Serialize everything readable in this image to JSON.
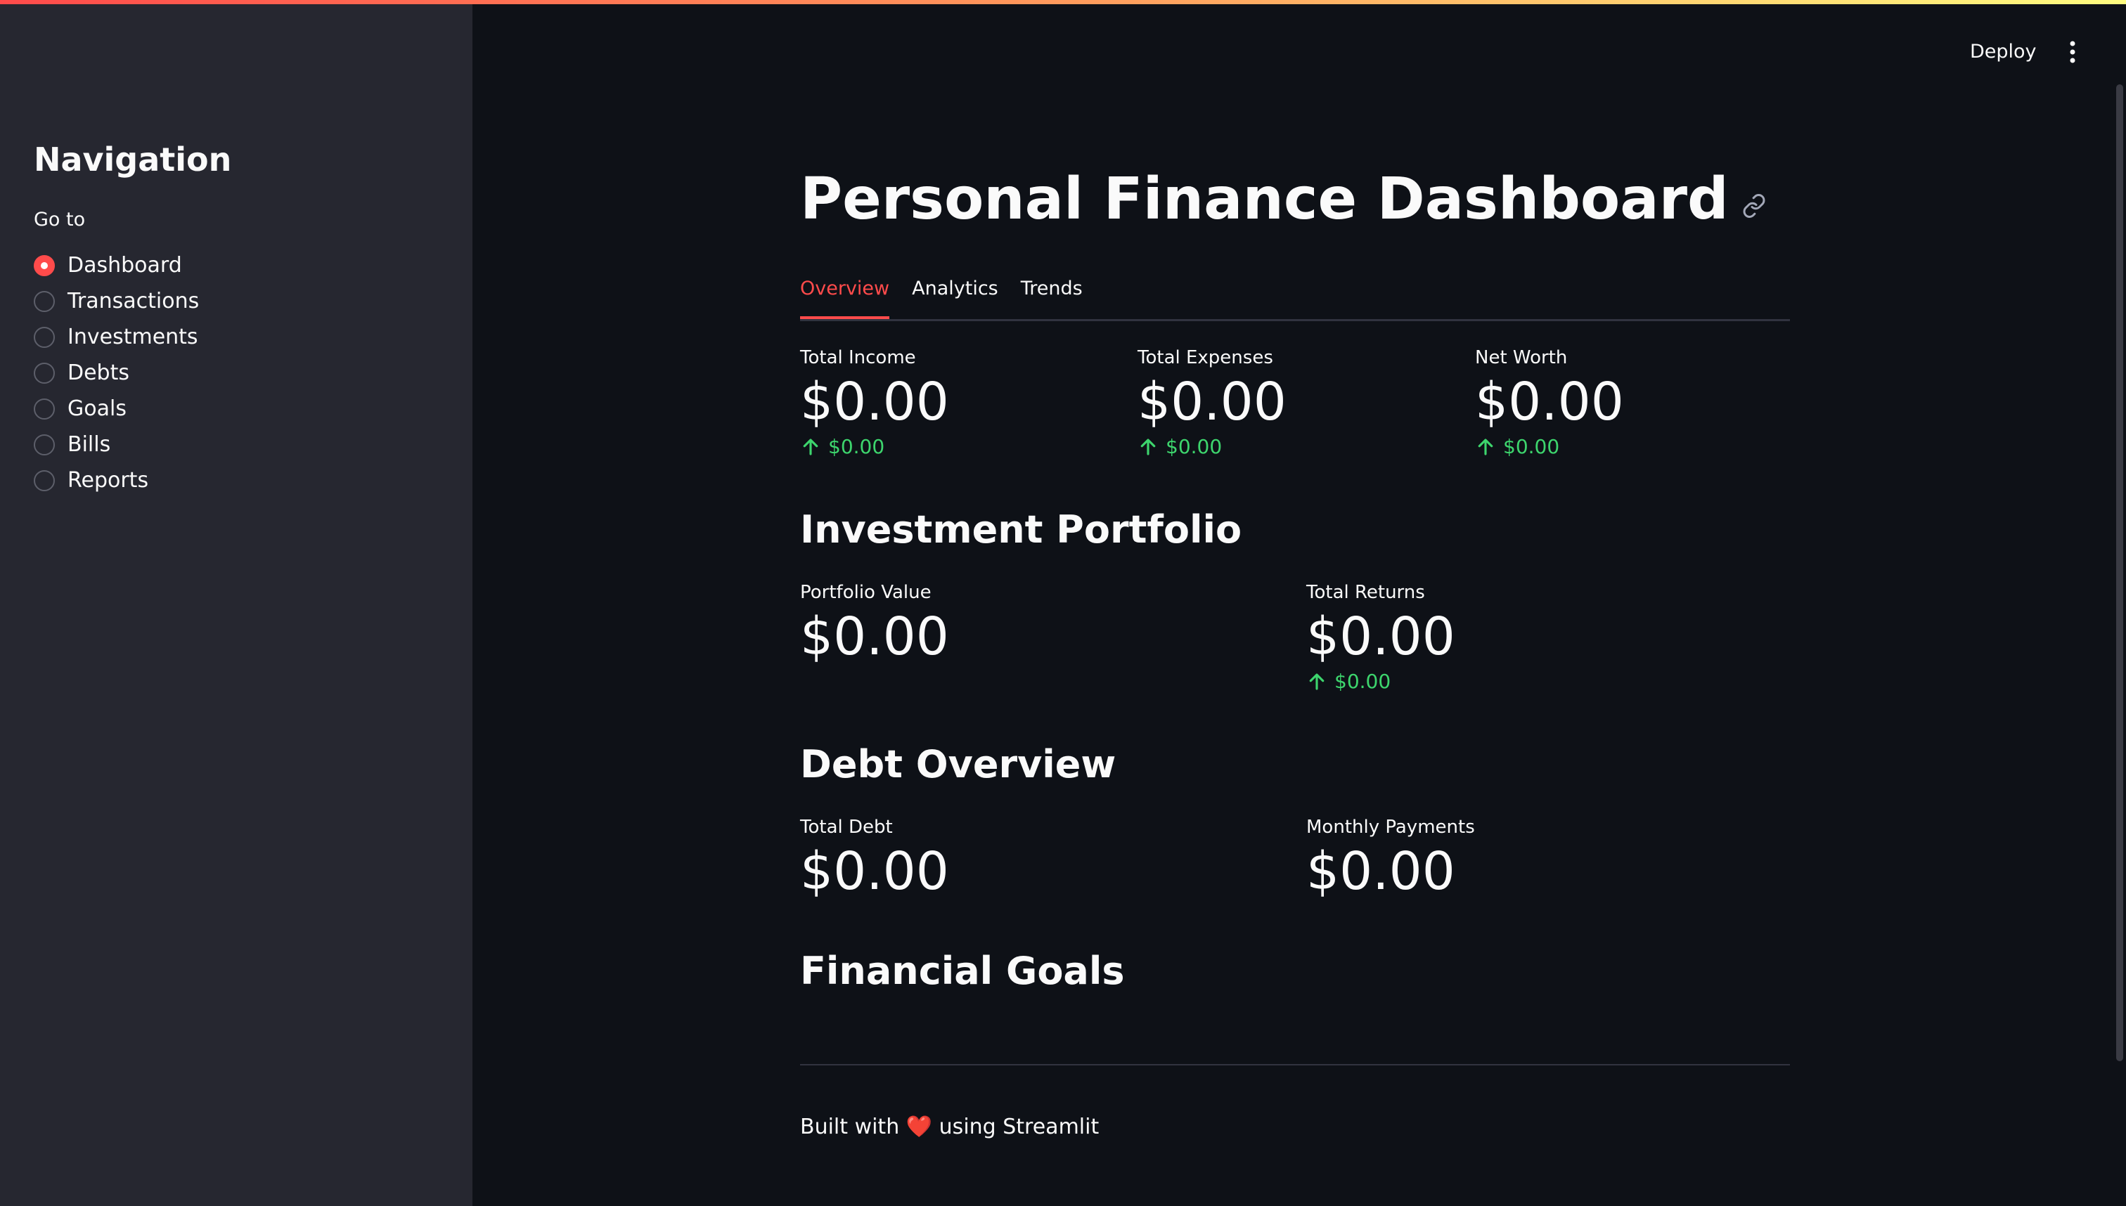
{
  "app": {
    "deploy_label": "Deploy",
    "menu_icon": "kebab-menu-icon"
  },
  "sidebar": {
    "title": "Navigation",
    "radio_label": "Go to",
    "items": [
      {
        "label": "Dashboard",
        "selected": true
      },
      {
        "label": "Transactions",
        "selected": false
      },
      {
        "label": "Investments",
        "selected": false
      },
      {
        "label": "Debts",
        "selected": false
      },
      {
        "label": "Goals",
        "selected": false
      },
      {
        "label": "Bills",
        "selected": false
      },
      {
        "label": "Reports",
        "selected": false
      }
    ]
  },
  "main": {
    "title": "Personal Finance Dashboard",
    "tabs": [
      {
        "label": "Overview",
        "active": true
      },
      {
        "label": "Analytics",
        "active": false
      },
      {
        "label": "Trends",
        "active": false
      }
    ],
    "overview_metrics": [
      {
        "label": "Total Income",
        "value": "$0.00",
        "delta": "$0.00"
      },
      {
        "label": "Total Expenses",
        "value": "$0.00",
        "delta": "$0.00"
      },
      {
        "label": "Net Worth",
        "value": "$0.00",
        "delta": "$0.00"
      }
    ],
    "investment": {
      "heading": "Investment Portfolio",
      "metrics": [
        {
          "label": "Portfolio Value",
          "value": "$0.00"
        },
        {
          "label": "Total Returns",
          "value": "$0.00",
          "delta": "$0.00"
        }
      ]
    },
    "debt": {
      "heading": "Debt Overview",
      "metrics": [
        {
          "label": "Total Debt",
          "value": "$0.00"
        },
        {
          "label": "Monthly Payments",
          "value": "$0.00"
        }
      ]
    },
    "goals": {
      "heading": "Financial Goals"
    },
    "footer": {
      "prefix": "Built with",
      "heart": "❤️",
      "suffix": "using Streamlit"
    }
  },
  "colors": {
    "accent": "#ff4b4b",
    "delta_positive": "#3dd56d",
    "sidebar_bg": "#262730",
    "main_bg": "#0e1117"
  }
}
